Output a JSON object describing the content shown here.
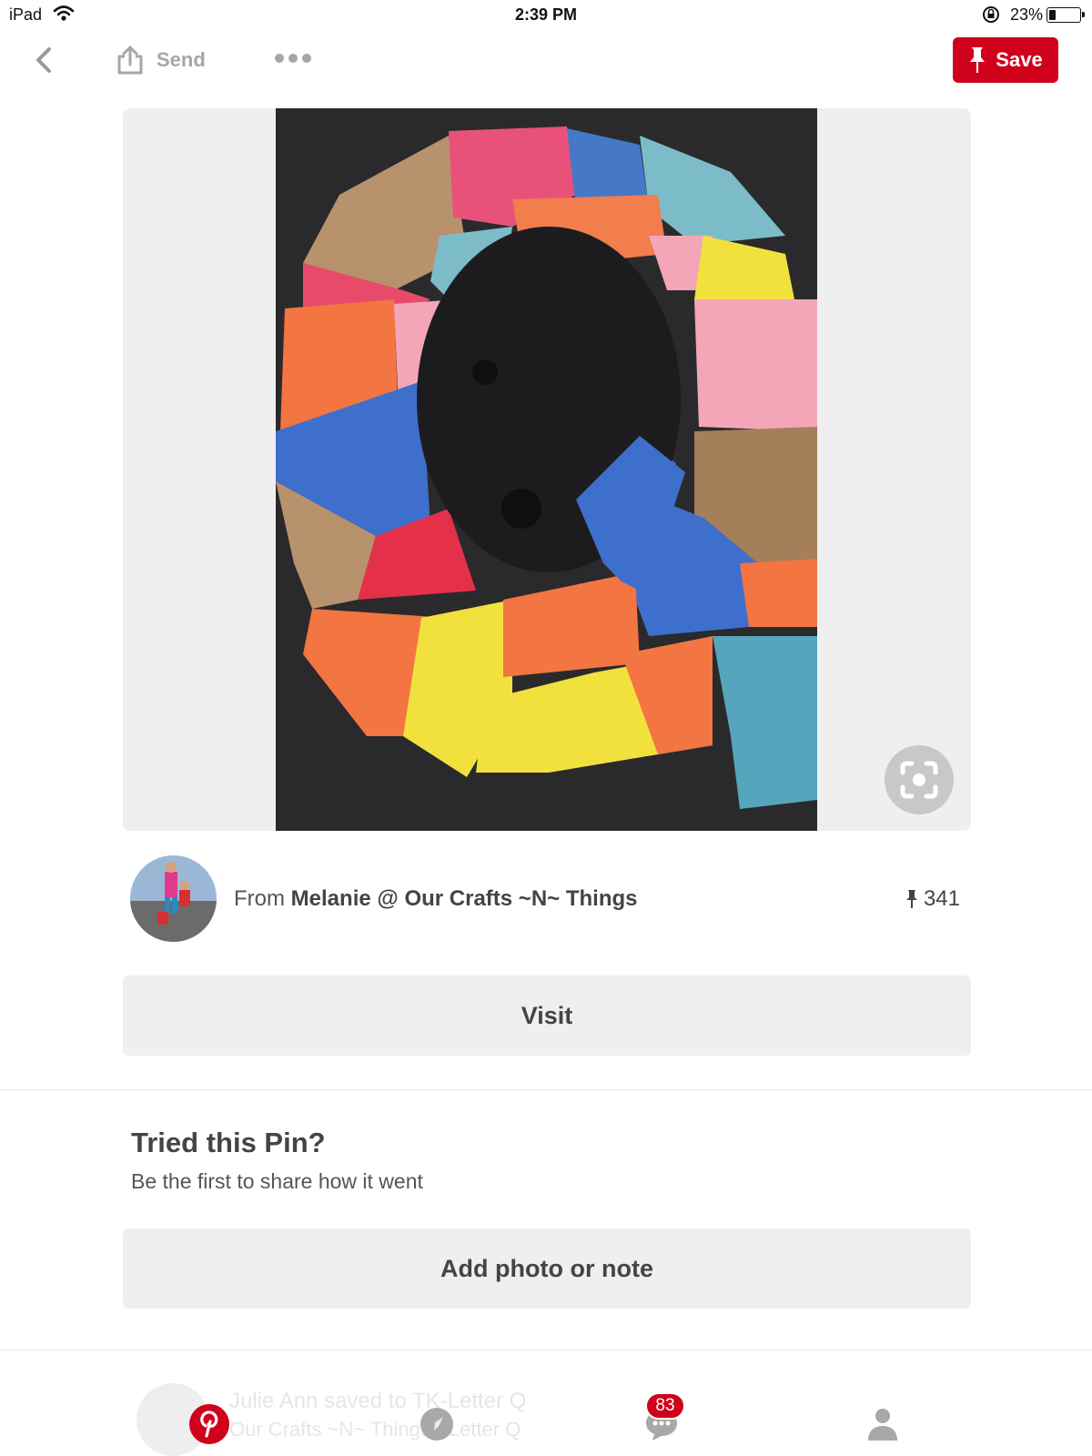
{
  "status_bar": {
    "carrier": "iPad",
    "time": "2:39 PM",
    "battery": "23%",
    "battery_level": 0.23
  },
  "header": {
    "send_label": "Send",
    "save_label": "Save"
  },
  "pin": {
    "source_prefix": "From",
    "source_name": "Melanie @ Our Crafts ~N~ Things",
    "save_count": "341",
    "visit_label": "Visit"
  },
  "tried": {
    "title": "Tried this Pin?",
    "subtitle": "Be the first to share how it went",
    "button_label": "Add photo or note"
  },
  "activity": {
    "line1": "Julie Ann saved to TK-Letter Q",
    "line2": "Our Crafts ~N~ Things • Letter Q"
  },
  "tab_bar": {
    "messages_badge": "83",
    "icons": [
      "pinterest-logo-icon",
      "compass-icon",
      "chat-bubble-icon",
      "person-icon"
    ]
  },
  "colors": {
    "brand_red": "#d0011b",
    "button_grey": "#efefef"
  }
}
